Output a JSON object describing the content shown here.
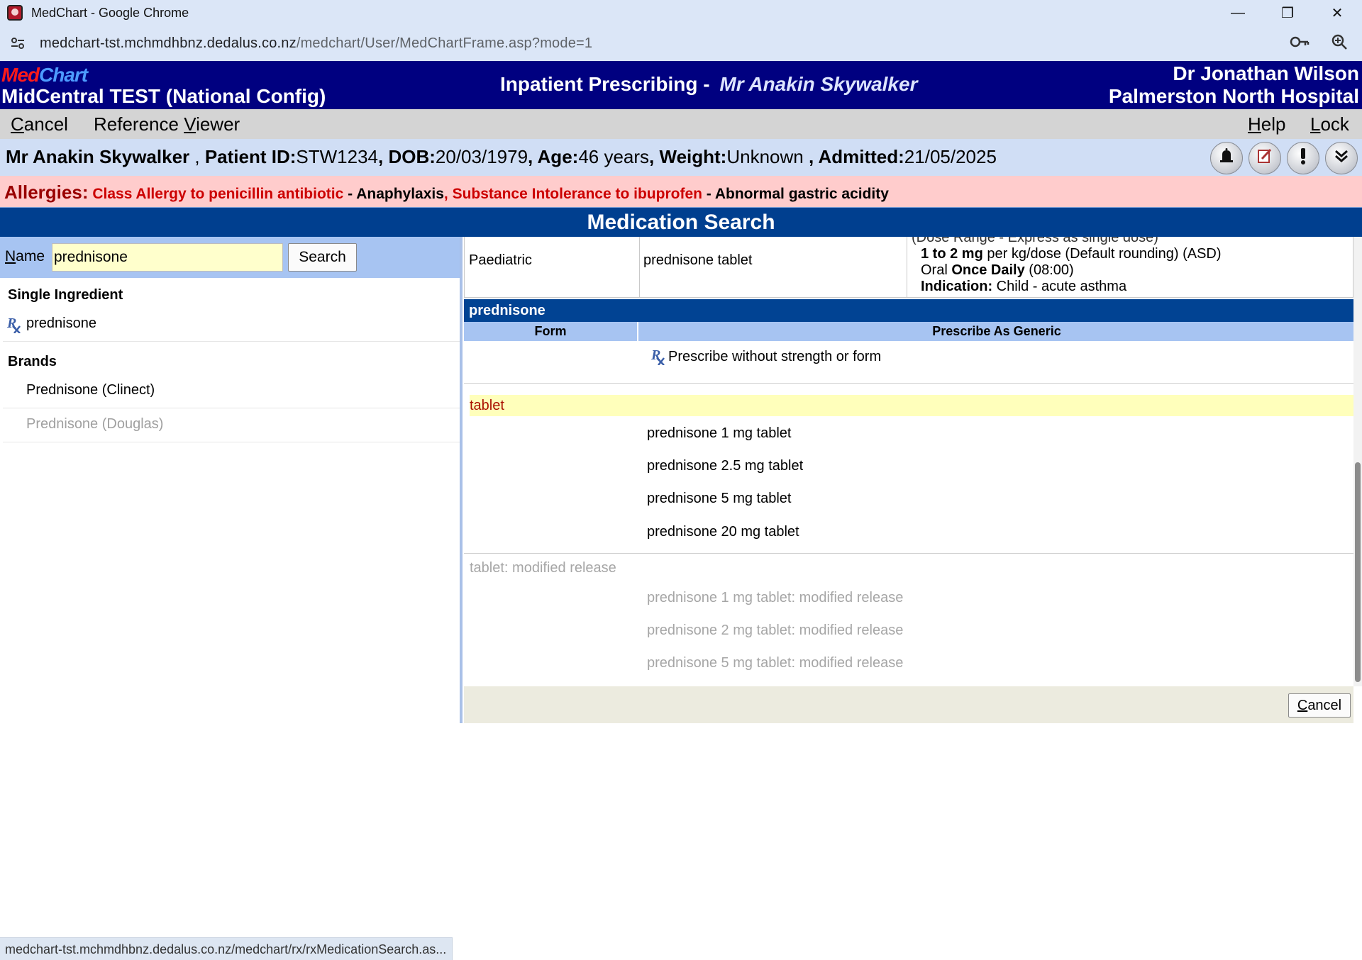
{
  "browser": {
    "window_title": "MedChart - Google Chrome",
    "url_host": "medchart-tst.mchmdhbnz.dedalus.co.nz",
    "url_path": "/medchart/User/MedChartFrame.asp?mode=1",
    "controls": {
      "minimize": "—",
      "restore": "❐",
      "close": "✕"
    }
  },
  "header": {
    "logo_med": "Med",
    "logo_chart": "Chart",
    "site_name": "MidCentral TEST (National Config)",
    "module": "Inpatient Prescribing - ",
    "patient_name": "Mr Anakin Skywalker",
    "doctor": "Dr Jonathan Wilson",
    "hospital": "Palmerston North Hospital"
  },
  "menu": {
    "cancel_first": "C",
    "cancel_rest": "ancel",
    "refviewer_a": "Reference ",
    "refviewer_u": "V",
    "refviewer_b": "iewer",
    "help_u": "H",
    "help_rest": "elp",
    "lock_u": "L",
    "lock_rest": "ock"
  },
  "patient": {
    "name": "Mr Anakin Skywalker",
    "sep1": " , ",
    "id_label": "Patient ID:",
    "id": "STW1234",
    "dob_label": "DOB:",
    "dob": "20/03/1979",
    "age_label": "Age:",
    "age": "46 years",
    "weight_label": "Weight:",
    "weight": "Unknown",
    "admitted_label": "Admitted:",
    "admitted": "21/05/2025"
  },
  "allergies": {
    "label": "Allergies:",
    "a1": "Class Allergy to penicillin antibiotic",
    "r1": " - Anaphylaxis",
    "a2": ", Substance Intolerance to ibuprofen",
    "r2": " - Abnormal gastric acidity"
  },
  "section_title": "Medication Search",
  "search": {
    "label_u": "N",
    "label_rest": "ame",
    "value": "prednisone",
    "button": "Search"
  },
  "results": {
    "single_heading": "Single Ingredient",
    "single_items": [
      "prednisone"
    ],
    "brands_heading": "Brands",
    "brand_items": [
      "Prednisone (Clinect)",
      "Prednisone (Douglas)"
    ]
  },
  "paediatric_row": {
    "group": "Paediatric",
    "product": "prednisone tablet",
    "dose_cut": "(Dose Range - Express as single dose)",
    "dose_range": "1 to 2 mg",
    "dose_unit": " per kg/dose (Default rounding) (ASD)",
    "route": "Oral ",
    "freq": "Once Daily",
    "time": " (08:00)",
    "indication_label": "Indication:",
    "indication": " Child - acute asthma"
  },
  "medication": {
    "name": "prednisone",
    "col_form": "Form",
    "col_generic": "Prescribe As Generic",
    "generic_option": "Prescribe without strength or form",
    "forms": [
      {
        "label": "tablet",
        "strengths": [
          "prednisone 1 mg tablet",
          "prednisone 2.5 mg tablet",
          "prednisone 5 mg tablet",
          "prednisone 20 mg tablet"
        ]
      },
      {
        "label": "tablet: modified release",
        "strengths": [
          "prednisone 1 mg tablet: modified release",
          "prednisone 2 mg tablet: modified release",
          "prednisone 5 mg tablet: modified release"
        ]
      }
    ]
  },
  "footer": {
    "cancel_u": "C",
    "cancel_rest": "ancel",
    "status_url": "medchart-tst.mchmdhbnz.dedalus.co.nz/medchart/rx/rxMedicationSearch.as..."
  },
  "icons": {
    "patient_bar": [
      "bell-icon",
      "edit-notes-icon",
      "alert-icon",
      "expand-down-icon"
    ],
    "rx": "rx-icon"
  },
  "colors": {
    "header_bg": "#000080",
    "section_bg": "#003f8f",
    "allergy_bg": "#ffcccc",
    "allergen_text": "#cc0000",
    "highlight_row": "#ffffbb",
    "search_bg": "#a7c4f2"
  }
}
